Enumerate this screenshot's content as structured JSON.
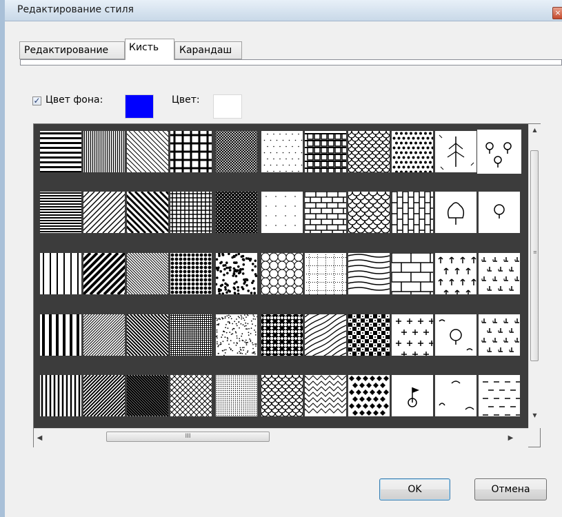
{
  "window": {
    "title": "Редактирование стиля",
    "close_glyph": "×"
  },
  "tabs": [
    {
      "label": "Редактирование",
      "active": false
    },
    {
      "label": "Кисть",
      "active": true
    },
    {
      "label": "Карандаш",
      "active": false
    }
  ],
  "fill": {
    "background_checkbox_checked": true,
    "checkbox_glyph": "✓",
    "background_label": "Цвет фона:",
    "background_color": "#0000ff",
    "color_label": "Цвет:",
    "color_value": "#ffffff"
  },
  "pattern_grid": {
    "selected_index": 10,
    "rows": [
      [
        "horizontal-lines-wide",
        "vertical-lines-dense",
        "diagonal-lines-thin",
        "grid-large",
        "crosshatch-dense",
        "dots-sparse",
        "brick-grid",
        "wave-scale",
        "dots-grid",
        "tree-sketch",
        "trees-small"
      ],
      [
        "horizontal-lines-dense",
        "diagonal-lines-right",
        "diagonal-lines-left-thick",
        "grid-medium",
        "checker-fine",
        "dots-very-sparse",
        "brick",
        "scales",
        "brick-vertical",
        "bush",
        "tree-icon"
      ],
      [
        "vertical-lines",
        "diagonal-lines-right-thick",
        "diagonal-lines-fine",
        "dots-large",
        "dots-random",
        "circles",
        "dotted-grid",
        "waves-ticks",
        "brick-large",
        "arrows-up",
        "grass-tufts"
      ],
      [
        "vertical-lines-thick",
        "diagonal-lines-fine-right",
        "diagonal-lines-left",
        "grid-fine",
        "dots-fine-random",
        "weave",
        "waves-diagonal",
        "checker-blocks",
        "plus-marks",
        "shrubs",
        "grass-marks"
      ],
      [
        "vertical-lines-medium",
        "diagonal-lines-dense-right",
        "diagonal-lines-dense-left",
        "diamond-grid",
        "dots-very-fine",
        "fishscale",
        "zigzag",
        "diamonds",
        "flag-symbol",
        "shrubs-sparse",
        "dashes"
      ]
    ]
  },
  "scrollbars": {
    "up_arrow": "▲",
    "down_arrow": "▼",
    "left_arrow": "◀",
    "right_arrow": "▶",
    "thumb_grip_vertical": "≡",
    "thumb_grip_horizontal": "III"
  },
  "buttons": {
    "ok": "OK",
    "cancel": "Отмена"
  }
}
